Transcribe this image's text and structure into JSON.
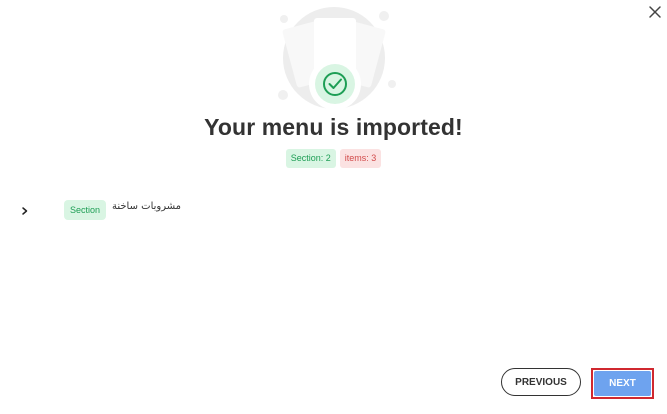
{
  "dialog": {
    "close_icon": "close-icon",
    "illustration_icon": "check-circle-icon",
    "title": "Your menu is imported!",
    "badges": {
      "section": "Section: 2",
      "items": "items: 3"
    }
  },
  "list": {
    "rows": [
      {
        "expand_icon": "chevron-right-icon",
        "type_badge": "Section",
        "label": "مشروبات ساخنة"
      }
    ]
  },
  "footer": {
    "previous_label": "PREVIOUS",
    "next_label": "NEXT"
  },
  "colors": {
    "success_green": "#1e9e55",
    "success_bg": "#d9f5e3",
    "error_red": "#d24b4b",
    "error_bg": "#fbe2e2",
    "primary_blue": "#6ea3ef",
    "highlight_red": "#d0282f",
    "text_dark": "#333333"
  }
}
